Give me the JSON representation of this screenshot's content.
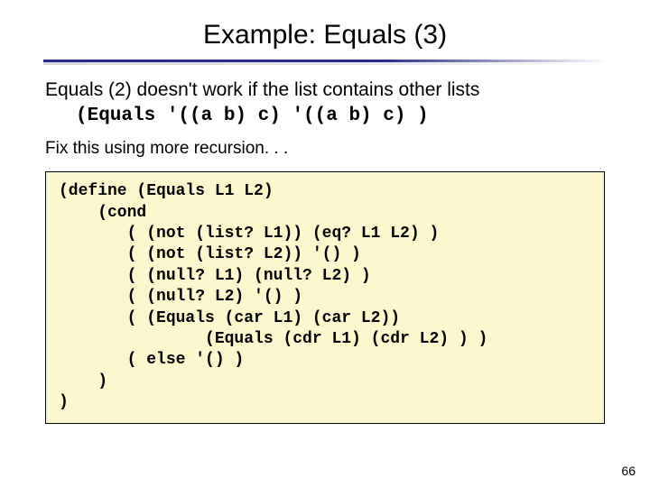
{
  "title": "Example: Equals (3)",
  "lead_text": "Equals (2) doesn't work if the list contains other lists",
  "lead_code": "(Equals '((a b) c) '((a b) c) )",
  "fix_text": "Fix this using more recursion. . .",
  "code": "(define (Equals L1 L2)\n    (cond\n       ( (not (list? L1)) (eq? L1 L2) )\n       ( (not (list? L2)) '() )\n       ( (null? L1) (null? L2) )\n       ( (null? L2) '() )\n       ( (Equals (car L1) (car L2))\n               (Equals (cdr L1) (cdr L2) ) )\n       ( else '() )\n    )\n)",
  "page_number": "66"
}
